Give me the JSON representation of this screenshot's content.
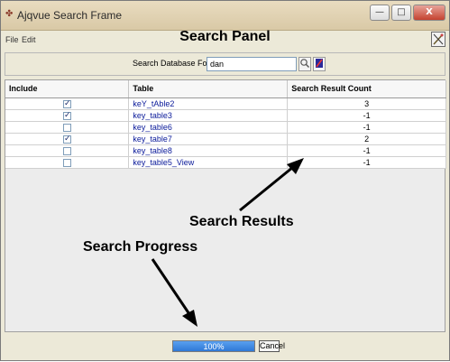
{
  "window": {
    "title": "Ajqvue Search Frame",
    "minimize": "—",
    "maximize": "□",
    "close": "X"
  },
  "menu": {
    "file": "File",
    "edit": "Edit"
  },
  "panel": {
    "title": "Search Panel"
  },
  "search": {
    "label": "Search Database For :",
    "value": "dan"
  },
  "table": {
    "headers": [
      "Include",
      "Table",
      "Search Result Count"
    ],
    "rows": [
      {
        "include": true,
        "name": "keY_tAble2",
        "count": "3"
      },
      {
        "include": true,
        "name": "key_table3",
        "count": "-1"
      },
      {
        "include": false,
        "name": "key_table6",
        "count": "-1"
      },
      {
        "include": true,
        "name": "key_table7",
        "count": "2"
      },
      {
        "include": false,
        "name": "key_table8",
        "count": "-1"
      },
      {
        "include": false,
        "name": "key_table5_View",
        "count": "-1"
      }
    ]
  },
  "annotations": {
    "results": "Search Results",
    "progress": "Search Progress"
  },
  "progress": {
    "text": "100%",
    "value": 1.0
  },
  "cancel": "Cancel"
}
